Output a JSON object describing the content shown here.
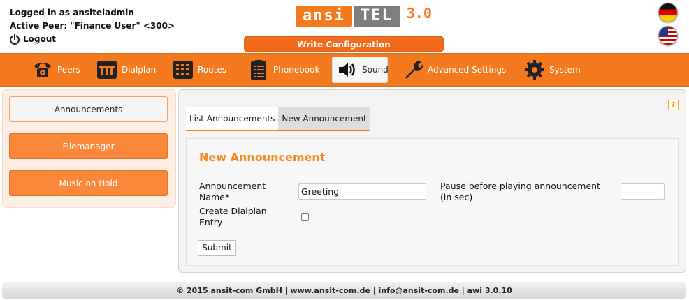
{
  "header": {
    "logged_in_as": "Logged in as ansiteladmin",
    "active_peer": "Active Peer: \"Finance User\" <300>",
    "logout_label": "Logout",
    "logo": {
      "part1": "ansi",
      "part2": "TEL",
      "version": "3.0"
    },
    "write_config_label": "Write Configuration",
    "flags": [
      "german-flag-icon",
      "us-flag-icon"
    ]
  },
  "nav": {
    "items": [
      {
        "label": "Peers",
        "icon": "telephone-icon"
      },
      {
        "label": "Dialplan",
        "icon": "dialplan-icon"
      },
      {
        "label": "Routes",
        "icon": "routes-icon"
      },
      {
        "label": "Phonebook",
        "icon": "phonebook-icon"
      },
      {
        "label": "Sound",
        "icon": "speaker-icon",
        "active": true
      },
      {
        "label": "Advanced Settings",
        "icon": "wrench-icon"
      },
      {
        "label": "System",
        "icon": "gear-icon"
      }
    ]
  },
  "sidebar": {
    "items": [
      {
        "label": "Announcements",
        "active": true
      },
      {
        "label": "Filemanager"
      },
      {
        "label": "Music on Hold"
      }
    ]
  },
  "main": {
    "help_label": "?",
    "tabs": [
      {
        "label": "List Announcements"
      },
      {
        "label": "New Announcement",
        "active": true
      }
    ],
    "form": {
      "title": "New Announcement",
      "name_label_line1": "Announcement",
      "name_label_line2": "Name*",
      "name_value": "Greeting",
      "pause_label_line1": "Pause before playing announcement",
      "pause_label_line2": "(in sec)",
      "pause_value": "",
      "dialplan_label_line1": "Create Dialplan",
      "dialplan_label_line2": "Entry",
      "dialplan_checked": false,
      "submit_label": "Submit"
    }
  },
  "footer": {
    "text": "© 2015 ansit-com GmbH | www.ansit-com.de | info@ansit-com.de | awi 3.0.10"
  },
  "colors": {
    "accent": "#f47a20",
    "accent_dark": "#f26b1d",
    "title_orange": "#f48a1e"
  }
}
